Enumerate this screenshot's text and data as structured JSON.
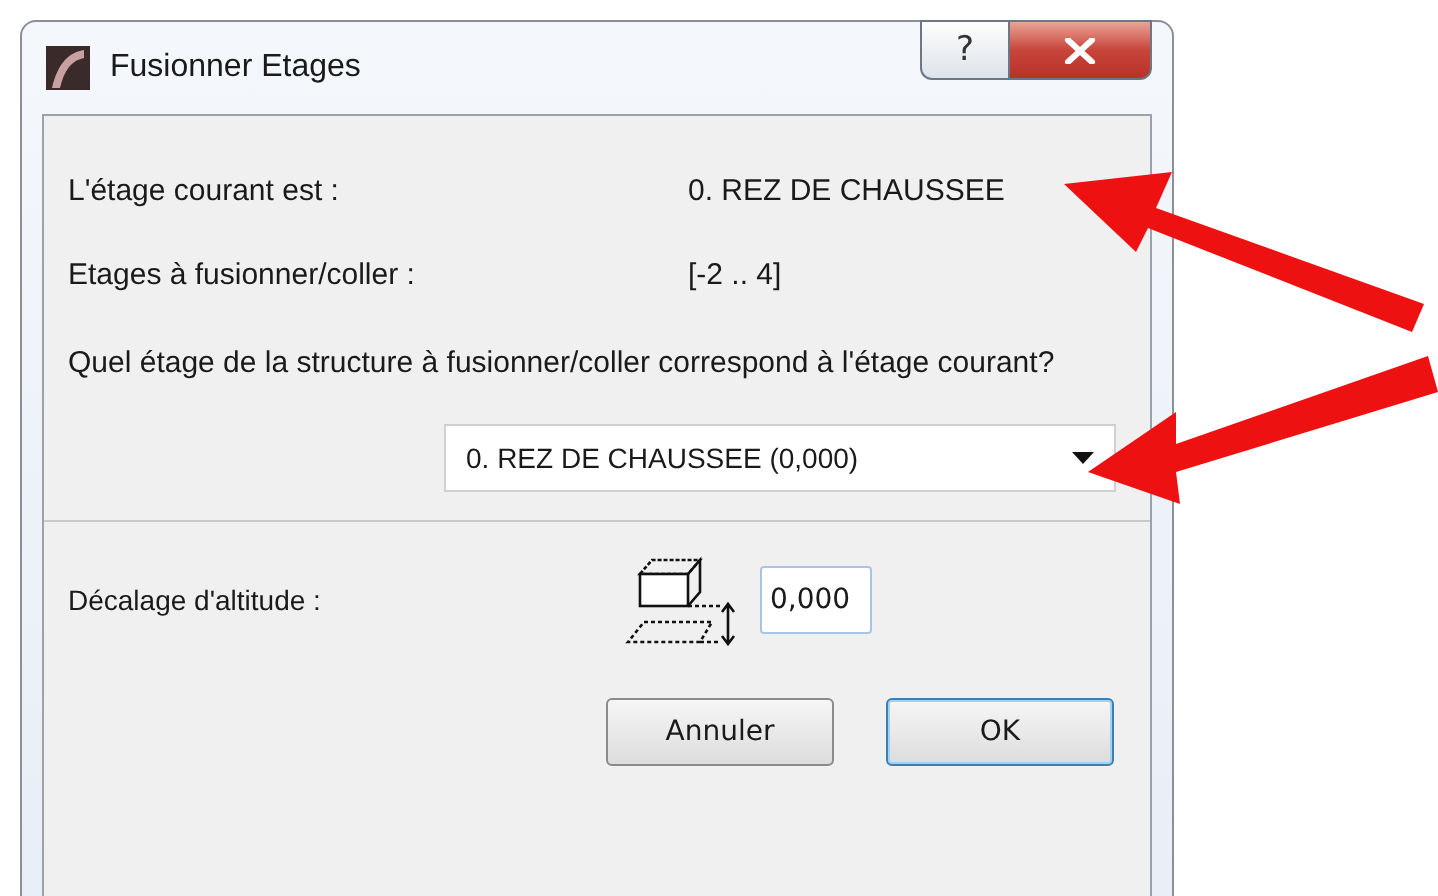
{
  "window": {
    "title": "Fusionner Etages",
    "controls": [
      {
        "kind": "help",
        "label": "?"
      },
      {
        "kind": "close"
      }
    ]
  },
  "info_rows": [
    {
      "label": "L'étage courant est :",
      "value": "0. REZ DE CHAUSSEE"
    },
    {
      "label": "Etages à fusionner/coller :",
      "value": "[-2 .. 4]"
    }
  ],
  "question": "Quel étage de la structure à fusionner/coller correspond à l'étage courant?",
  "story_select": {
    "value": "0. REZ DE CHAUSSEE (0,000)"
  },
  "offset": {
    "label": "Décalage d'altitude :",
    "value": "0,000"
  },
  "buttons": [
    {
      "label": "Annuler",
      "default": false
    },
    {
      "label": "OK",
      "default": true
    }
  ]
}
